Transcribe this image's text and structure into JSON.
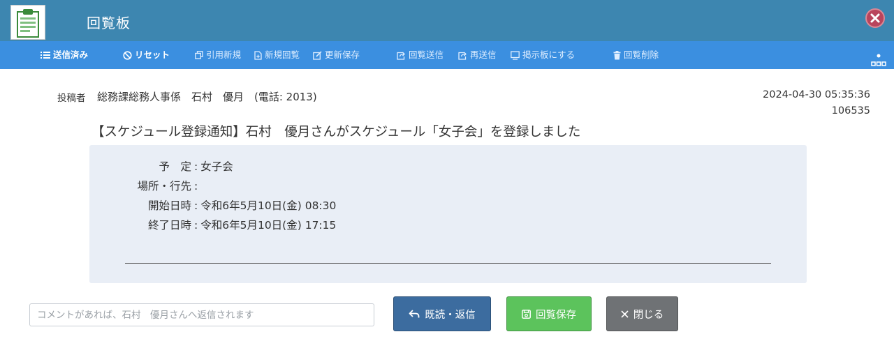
{
  "app": {
    "title": "回覧板",
    "icon": "clipboard-icon"
  },
  "toolbar": {
    "items": [
      {
        "label": "送信済み",
        "icon": "list-icon"
      },
      {
        "label": "リセット",
        "icon": "ban-icon"
      },
      {
        "label": "引用新規",
        "icon": "copy-icon"
      },
      {
        "label": "新規回覧",
        "icon": "new-doc-icon"
      },
      {
        "label": "更新保存",
        "icon": "edit-icon"
      },
      {
        "label": "回覧送信",
        "icon": "share-icon"
      },
      {
        "label": "再送信",
        "icon": "resend-icon"
      },
      {
        "label": "掲示板にする",
        "icon": "board-icon"
      },
      {
        "label": "回覧削除",
        "icon": "trash-icon"
      }
    ]
  },
  "post": {
    "author_label": "投稿者",
    "author": "総務課総務人事係　石村　優月　(電話: 2013)",
    "datetime": "2024-04-30 05:35:36",
    "id": "106535",
    "subject": "【スケジュール登録通知】石村　優月さんがスケジュール「女子会」を登録しました",
    "body": [
      {
        "label": "予　定",
        "value": "女子会"
      },
      {
        "label": "場所・行先",
        "value": ""
      },
      {
        "label": "開始日時",
        "value": "令和6年5月10日(金) 08:30"
      },
      {
        "label": "終了日時",
        "value": "令和6年5月10日(金) 17:15"
      }
    ]
  },
  "comment": {
    "placeholder": "コメントがあれば、石村　優月さんへ返信されます",
    "value": ""
  },
  "buttons": {
    "reply": "既読・返信",
    "save": "回覧保存",
    "close": "閉じる"
  },
  "colors": {
    "titlebar": "#3d86b0",
    "toolbar": "#3b8fe0",
    "reply": "#3c6c9f",
    "save": "#5cc35c",
    "close": "#6f7275",
    "body_bg": "#e9eef6"
  }
}
